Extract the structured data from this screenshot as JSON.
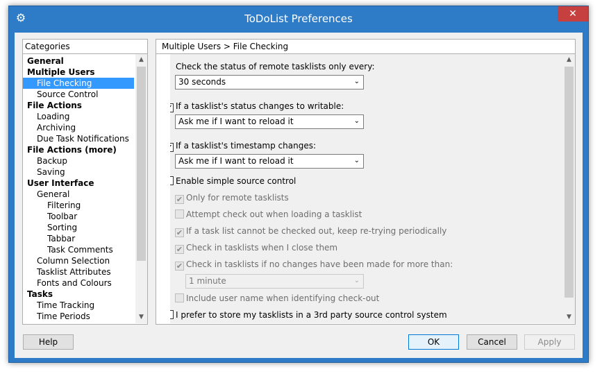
{
  "window": {
    "title": "ToDoList Preferences",
    "close_glyph": "✕",
    "accent_color": "#2e7cc7"
  },
  "categories": {
    "header": "Categories",
    "items": [
      {
        "label": "General",
        "level": 0,
        "bold": true,
        "selected": false
      },
      {
        "label": "Multiple Users",
        "level": 0,
        "bold": true,
        "selected": false
      },
      {
        "label": "File Checking",
        "level": 1,
        "bold": false,
        "selected": true
      },
      {
        "label": "Source Control",
        "level": 1,
        "bold": false,
        "selected": false
      },
      {
        "label": "File Actions",
        "level": 0,
        "bold": true,
        "selected": false
      },
      {
        "label": "Loading",
        "level": 1,
        "bold": false,
        "selected": false
      },
      {
        "label": "Archiving",
        "level": 1,
        "bold": false,
        "selected": false
      },
      {
        "label": "Due Task Notifications",
        "level": 1,
        "bold": false,
        "selected": false
      },
      {
        "label": "File Actions (more)",
        "level": 0,
        "bold": true,
        "selected": false
      },
      {
        "label": "Backup",
        "level": 1,
        "bold": false,
        "selected": false
      },
      {
        "label": "Saving",
        "level": 1,
        "bold": false,
        "selected": false
      },
      {
        "label": "User Interface",
        "level": 0,
        "bold": true,
        "selected": false
      },
      {
        "label": "General",
        "level": 1,
        "bold": false,
        "selected": false
      },
      {
        "label": "Filtering",
        "level": 2,
        "bold": false,
        "selected": false
      },
      {
        "label": "Toolbar",
        "level": 2,
        "bold": false,
        "selected": false
      },
      {
        "label": "Sorting",
        "level": 2,
        "bold": false,
        "selected": false
      },
      {
        "label": "Tabbar",
        "level": 2,
        "bold": false,
        "selected": false
      },
      {
        "label": "Task Comments",
        "level": 2,
        "bold": false,
        "selected": false
      },
      {
        "label": "Column Selection",
        "level": 1,
        "bold": false,
        "selected": false
      },
      {
        "label": "Tasklist Attributes",
        "level": 1,
        "bold": false,
        "selected": false
      },
      {
        "label": "Fonts and Colours",
        "level": 1,
        "bold": false,
        "selected": false
      },
      {
        "label": "Tasks",
        "level": 0,
        "bold": true,
        "selected": false
      },
      {
        "label": "Time Tracking",
        "level": 1,
        "bold": false,
        "selected": false
      },
      {
        "label": "Time Periods",
        "level": 1,
        "bold": false,
        "selected": false
      }
    ]
  },
  "page": {
    "breadcrumb": "Multiple Users > File Checking",
    "check_interval_label": "Check the status of remote tasklists only every:",
    "check_interval_value": "30 seconds",
    "writable_label": "If a tasklist's status changes to writable:",
    "writable_checked": true,
    "writable_value": "Ask me if I want to reload it",
    "timestamp_label": "If a tasklist's timestamp changes:",
    "timestamp_checked": true,
    "timestamp_value": "Ask me if I want to reload it",
    "source_control_label": "Enable simple source control",
    "source_control_checked": false,
    "sub_options": [
      {
        "label": "Only for remote tasklists",
        "checked": true
      },
      {
        "label": "Attempt check out when loading a tasklist",
        "checked": false
      },
      {
        "label": "If a task list cannot be checked out, keep re-trying periodically",
        "checked": true
      },
      {
        "label": "Check in tasklists when I close them",
        "checked": true
      },
      {
        "label": "Check in tasklists if no changes have been made for more than:",
        "checked": true
      }
    ],
    "checkin_interval_value": "1 minute",
    "include_user_label": "Include user name when identifying check-out",
    "include_user_checked": false,
    "third_party_label": "I prefer to store my tasklists in a 3rd party source control system",
    "third_party_checked": false
  },
  "buttons": {
    "help": "Help",
    "ok": "OK",
    "cancel": "Cancel",
    "apply": "Apply"
  },
  "icons": {
    "app": "gear-icon",
    "check": "✔",
    "scroll_up": "▲",
    "scroll_down": "▼",
    "dropdown": "⌄"
  }
}
